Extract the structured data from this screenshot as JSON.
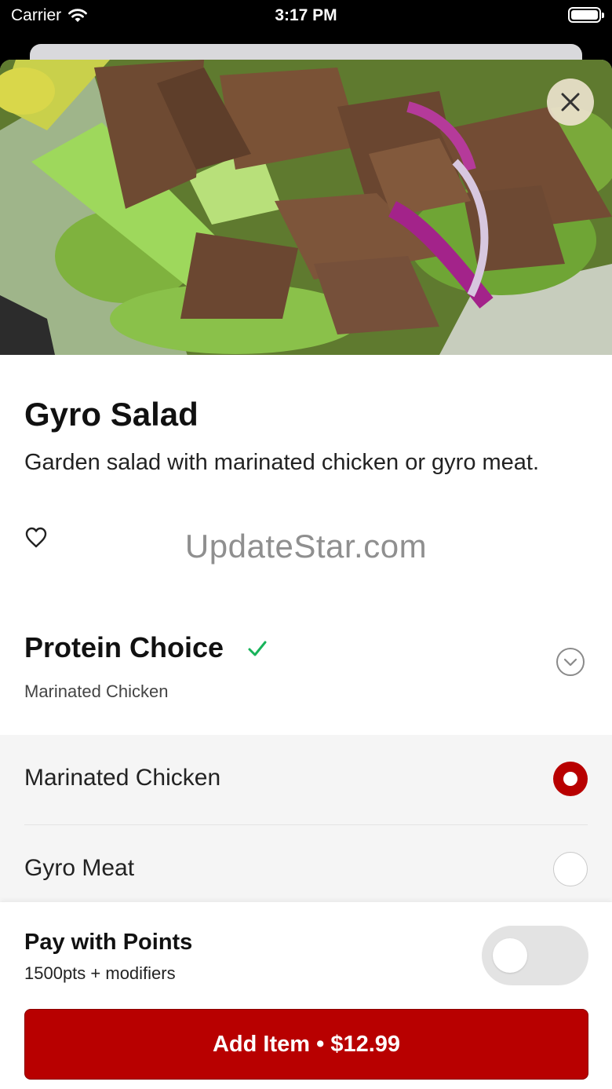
{
  "status_bar": {
    "carrier": "Carrier",
    "time": "3:17 PM"
  },
  "hero": {
    "image_description": "gyro meat salad photo",
    "close_icon": "close-icon"
  },
  "item": {
    "title": "Gyro Salad",
    "description": "Garden salad with marinated chicken or gyro meat.",
    "favorite_icon": "heart-outline-icon"
  },
  "watermark": "UpdateStar.com",
  "protein_section": {
    "title": "Protein Choice",
    "selected_summary": "Marinated Chicken",
    "status_icon": "checkmark-icon",
    "expand_icon": "chevron-down-icon",
    "options": [
      {
        "label": "Marinated Chicken",
        "selected": true
      },
      {
        "label": "Gyro Meat",
        "selected": false
      }
    ]
  },
  "footer": {
    "pay_title": "Pay with Points",
    "pay_subtitle": "1500pts + modifiers",
    "pay_toggle_on": false,
    "add_label": "Add Item",
    "separator": "•",
    "price": "$12.99"
  },
  "colors": {
    "accent": "#b80000",
    "check": "#18b35a",
    "option_bg": "#f5f5f5"
  }
}
